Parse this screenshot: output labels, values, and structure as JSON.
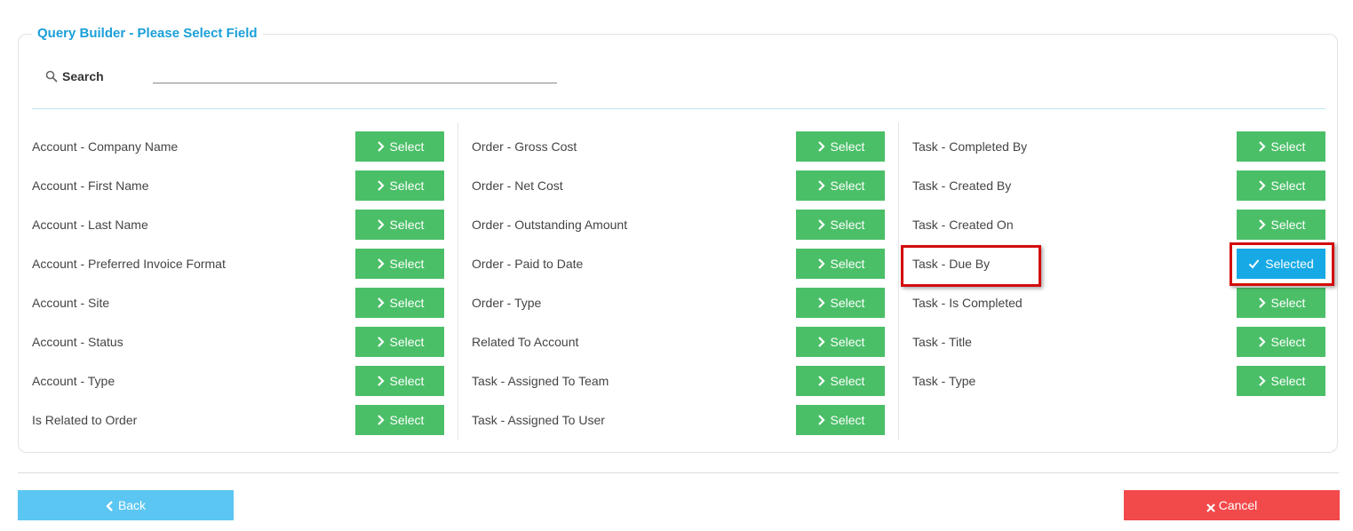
{
  "panel": {
    "title": "Query Builder - Please Select Field"
  },
  "search": {
    "label": "Search",
    "value": "",
    "placeholder": ""
  },
  "columns": [
    {
      "fields": [
        {
          "label": "Account - Company Name",
          "button": "Select",
          "selected": false
        },
        {
          "label": "Account - First Name",
          "button": "Select",
          "selected": false
        },
        {
          "label": "Account - Last Name",
          "button": "Select",
          "selected": false
        },
        {
          "label": "Account - Preferred Invoice Format",
          "button": "Select",
          "selected": false
        },
        {
          "label": "Account - Site",
          "button": "Select",
          "selected": false
        },
        {
          "label": "Account - Status",
          "button": "Select",
          "selected": false
        },
        {
          "label": "Account - Type",
          "button": "Select",
          "selected": false
        },
        {
          "label": "Is Related to Order",
          "button": "Select",
          "selected": false
        }
      ]
    },
    {
      "fields": [
        {
          "label": "Order - Gross Cost",
          "button": "Select",
          "selected": false
        },
        {
          "label": "Order - Net Cost",
          "button": "Select",
          "selected": false
        },
        {
          "label": "Order - Outstanding Amount",
          "button": "Select",
          "selected": false
        },
        {
          "label": "Order - Paid to Date",
          "button": "Select",
          "selected": false
        },
        {
          "label": "Order - Type",
          "button": "Select",
          "selected": false
        },
        {
          "label": "Related To Account",
          "button": "Select",
          "selected": false
        },
        {
          "label": "Task - Assigned To Team",
          "button": "Select",
          "selected": false
        },
        {
          "label": "Task - Assigned To User",
          "button": "Select",
          "selected": false
        }
      ]
    },
    {
      "fields": [
        {
          "label": "Task - Completed By",
          "button": "Select",
          "selected": false
        },
        {
          "label": "Task - Created By",
          "button": "Select",
          "selected": false
        },
        {
          "label": "Task - Created On",
          "button": "Select",
          "selected": false
        },
        {
          "label": "Task - Due By",
          "button": "Selected",
          "selected": true
        },
        {
          "label": "Task - Is Completed",
          "button": "Select",
          "selected": false
        },
        {
          "label": "Task - Title",
          "button": "Select",
          "selected": false
        },
        {
          "label": "Task - Type",
          "button": "Select",
          "selected": false
        }
      ]
    }
  ],
  "footer": {
    "back_label": "Back",
    "cancel_label": "Cancel"
  },
  "colors": {
    "accent": "#1a9fd9",
    "select_button": "#4bbf68",
    "selected_button": "#16a9e6",
    "back_button": "#5bc6f2",
    "cancel_button": "#f2494b",
    "highlight": "#d40c0c"
  },
  "icons": {
    "search": "search-icon",
    "select": "chevron-right-icon",
    "selected": "check-icon",
    "back": "chevron-left-icon",
    "cancel": "close-icon"
  }
}
